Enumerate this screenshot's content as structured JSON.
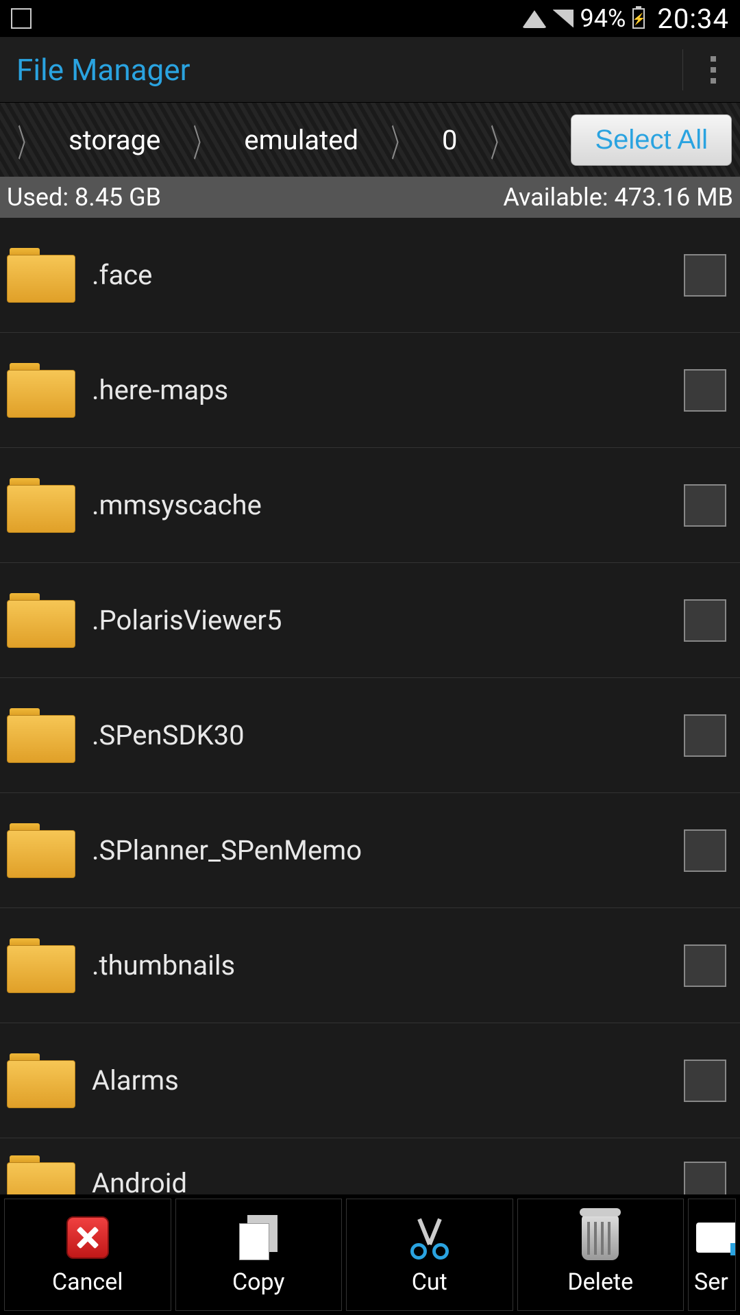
{
  "status": {
    "battery": "94%",
    "time": "20:34"
  },
  "app": {
    "title": "File Manager"
  },
  "breadcrumb": {
    "seg1": "storage",
    "seg2": "emulated",
    "seg3": "0",
    "select_all": "Select All"
  },
  "storage": {
    "used": "Used: 8.45 GB",
    "available": "Available: 473.16 MB"
  },
  "files": {
    "f0": ".face",
    "f1": ".here-maps",
    "f2": ".mmsyscache",
    "f3": ".PolarisViewer5",
    "f4": ".SPenSDK30",
    "f5": ".SPlanner_SPenMemo",
    "f6": ".thumbnails",
    "f7": "Alarms",
    "f8": "Android"
  },
  "toolbar": {
    "cancel": "Cancel",
    "copy": "Copy",
    "cut": "Cut",
    "delete": "Delete",
    "send": "Ser"
  }
}
